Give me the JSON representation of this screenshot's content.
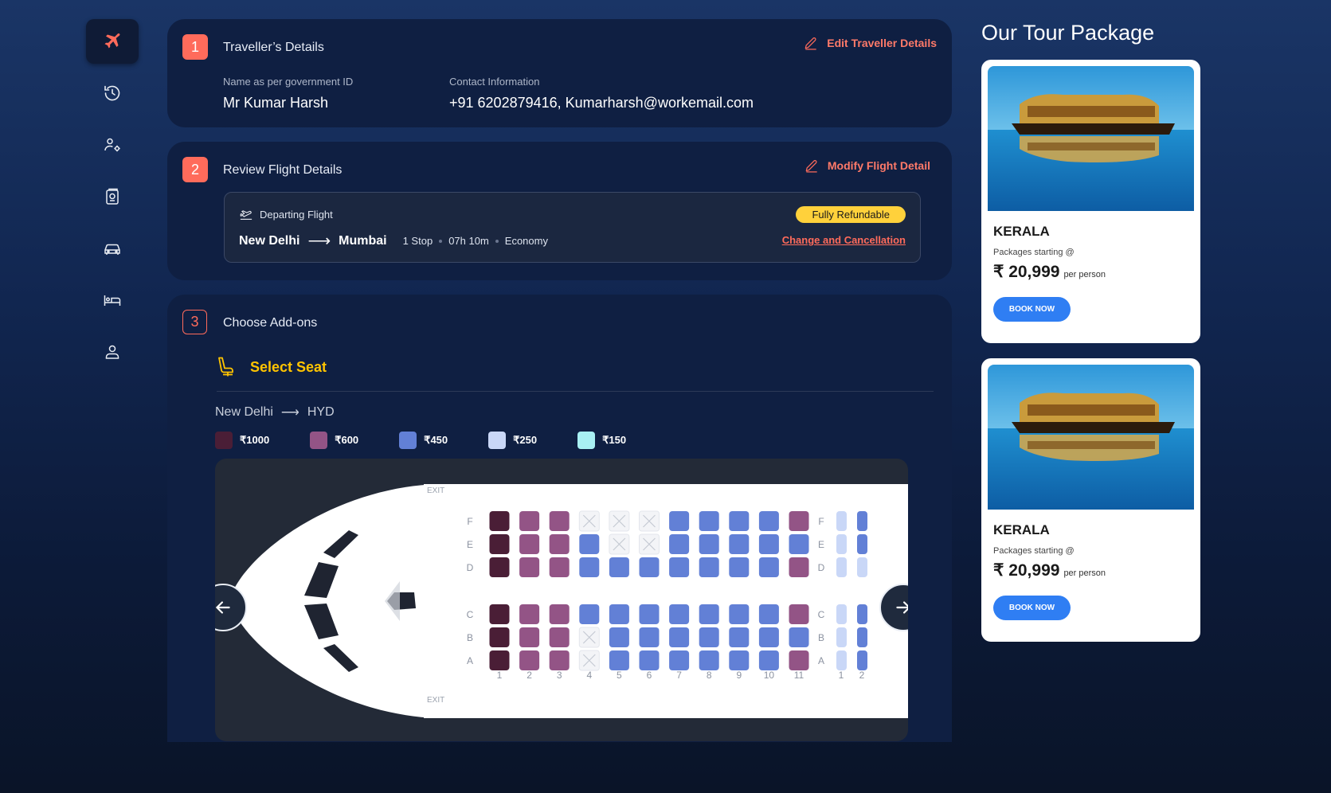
{
  "nav": {
    "items": [
      {
        "icon": "airplane-icon",
        "active": true
      },
      {
        "icon": "history-icon"
      },
      {
        "icon": "user-settings-icon"
      },
      {
        "icon": "passport-icon"
      },
      {
        "icon": "car-icon"
      },
      {
        "icon": "bed-icon"
      },
      {
        "icon": "profile-icon"
      }
    ]
  },
  "traveller": {
    "step": "1",
    "title": "Traveller’s Details",
    "edit_label": "Edit Traveller Details",
    "name_label": "Name as per government ID",
    "name_value": "Mr Kumar Harsh",
    "contact_label": "Contact Information",
    "contact_value": "+91 6202879416,  Kumarharsh@workemail.com"
  },
  "flight": {
    "step": "2",
    "title": "Review Flight Details",
    "modify_label": "Modify Flight Detail",
    "departing_label": "Departing Flight",
    "from": "New Delhi",
    "to": "Mumbai",
    "stops": "1 Stop",
    "duration": "07h 10m",
    "cabin": "Economy",
    "refund_badge": "Fully Refundable",
    "change_link": "Change and Cancellation"
  },
  "addons": {
    "step": "3",
    "title": "Choose Add-ons",
    "seat_title": "Select Seat",
    "sector_from": "New Delhi",
    "sector_to": "HYD",
    "legend": [
      {
        "price": "₹1000",
        "color": "#4a1e36"
      },
      {
        "price": "₹600",
        "color": "#935486"
      },
      {
        "price": "₹450",
        "color": "#6280d6"
      },
      {
        "price": "₹250",
        "color": "#c9d7f7"
      },
      {
        "price": "₹150",
        "color": "#a8f0f3"
      }
    ],
    "exit_label": "EXIT",
    "row_letters": [
      "F",
      "E",
      "D",
      "C",
      "B",
      "A"
    ],
    "columns": [
      "1",
      "2",
      "3",
      "4",
      "5",
      "6",
      "7",
      "8",
      "9",
      "10",
      "11"
    ],
    "next_columns": [
      "1",
      "2"
    ],
    "seats": {
      "F": [
        "p1000",
        "p600",
        "p600",
        "x",
        "x",
        "x",
        "p450",
        "p450",
        "p450",
        "p450",
        "p600"
      ],
      "E": [
        "p1000",
        "p600",
        "p600",
        "p450",
        "x",
        "x",
        "p450",
        "p450",
        "p450",
        "p450",
        "p450"
      ],
      "D": [
        "p1000",
        "p600",
        "p600",
        "p450",
        "p450",
        "p450",
        "p450",
        "p450",
        "p450",
        "p450",
        "p600"
      ],
      "C": [
        "p1000",
        "p600",
        "p600",
        "p450",
        "p450",
        "p450",
        "p450",
        "p450",
        "p450",
        "p450",
        "p600"
      ],
      "B": [
        "p1000",
        "p600",
        "p600",
        "x",
        "p450",
        "p450",
        "p450",
        "p450",
        "p450",
        "p450",
        "p450"
      ],
      "A": [
        "p1000",
        "p600",
        "p600",
        "x",
        "p450",
        "p450",
        "p450",
        "p450",
        "p450",
        "p450",
        "p600"
      ]
    },
    "next_seats": {
      "F": [
        "p250",
        "p450"
      ],
      "E": [
        "p250",
        "p450"
      ],
      "D": [
        "p250",
        "p250"
      ],
      "C": [
        "p250",
        "p450"
      ],
      "B": [
        "p250",
        "p450"
      ],
      "A": [
        "p250",
        "p450"
      ]
    }
  },
  "tour": {
    "title": "Our Tour Package",
    "cards": [
      {
        "name": "KERALA",
        "sub": "Packages starting @",
        "price": "₹ 20,999",
        "per": "per person",
        "button": "BOOK NOW"
      },
      {
        "name": "KERALA",
        "sub": "Packages starting @",
        "price": "₹ 20,999",
        "per": "per person",
        "button": "BOOK NOW"
      }
    ]
  }
}
